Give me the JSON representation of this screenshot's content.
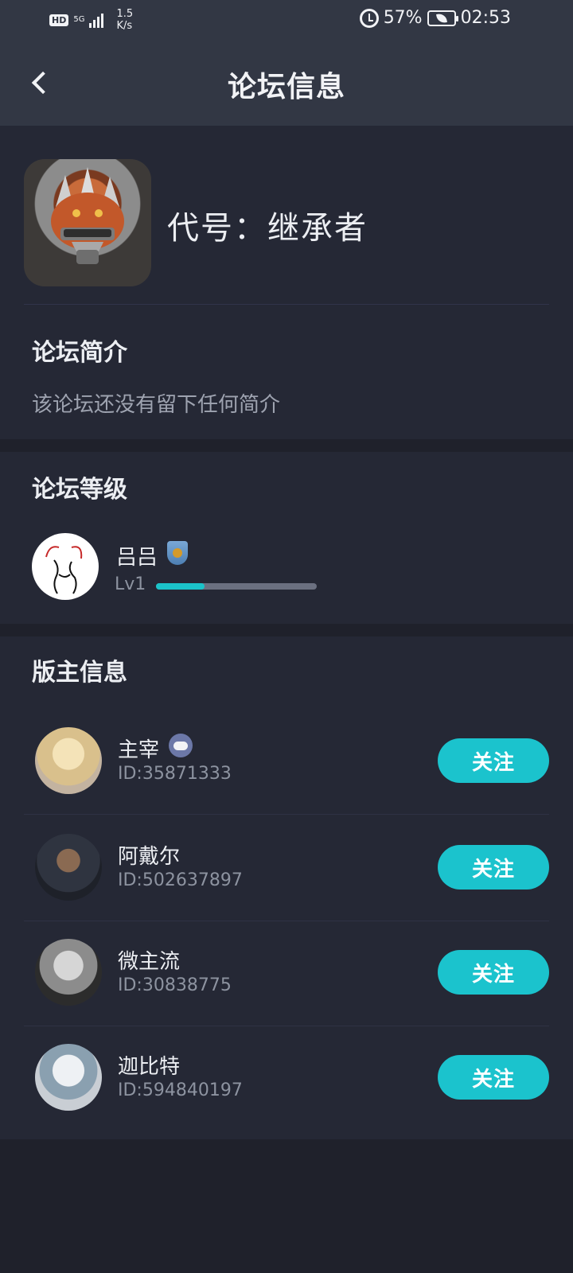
{
  "status_bar": {
    "hd": "HD",
    "network": "5G",
    "speed_value": "1.5",
    "speed_unit": "K/s",
    "battery": "57%",
    "time": "02:53"
  },
  "header": {
    "title": "论坛信息"
  },
  "forum": {
    "name": "代号：继承者",
    "intro_title": "论坛简介",
    "intro_text": "该论坛还没有留下任何简介"
  },
  "level": {
    "section_title": "论坛等级",
    "user_name": "吕吕",
    "level_label": "Lv1",
    "progress": 0.3
  },
  "moderators": {
    "section_title": "版主信息",
    "follow_label": "关注",
    "items": [
      {
        "name": "主宰",
        "id": "ID:35871333",
        "avatar_colors": [
          "#e8d7b0",
          "#c9b38c"
        ],
        "badge": "game-controller-icon"
      },
      {
        "name": "阿戴尔",
        "id": "ID:502637897",
        "avatar_colors": [
          "#3a3f4a",
          "#2b2e37"
        ]
      },
      {
        "name": "微主流",
        "id": "ID:30838775",
        "avatar_colors": [
          "#bfc0c2",
          "#3c3c3c"
        ]
      },
      {
        "name": "迦比特",
        "id": "ID:594840197",
        "avatar_colors": [
          "#dfe2e6",
          "#6c7c8a"
        ]
      }
    ]
  }
}
